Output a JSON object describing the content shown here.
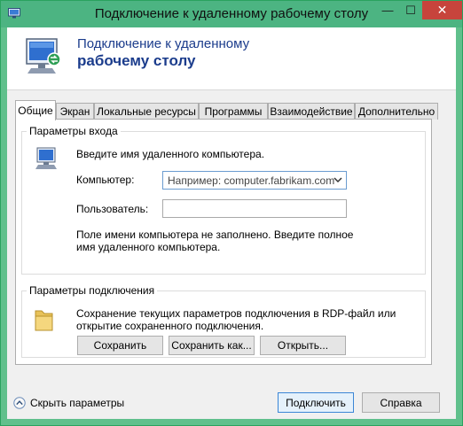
{
  "window": {
    "title": "Подключение к удаленному рабочему столу",
    "min_glyph": "—",
    "max_glyph": "☐",
    "close_glyph": "✕"
  },
  "banner": {
    "line1": "Подключение к удаленному",
    "line2": "рабочему столу"
  },
  "tabs": [
    {
      "label": "Общие",
      "active": true
    },
    {
      "label": "Экран"
    },
    {
      "label": "Локальные ресурсы"
    },
    {
      "label": "Программы"
    },
    {
      "label": "Взаимодействие"
    },
    {
      "label": "Дополнительно"
    }
  ],
  "login": {
    "group_title": "Параметры входа",
    "prompt": "Введите имя удаленного компьютера.",
    "computer_label": "Компьютер:",
    "computer_placeholder": "Например: computer.fabrikam.com",
    "user_label": "Пользователь:",
    "user_value": "",
    "hint_line1": "Поле имени компьютера не заполнено. Введите полное",
    "hint_line2": "имя удаленного компьютера."
  },
  "connection": {
    "group_title": "Параметры подключения",
    "desc_line1": "Сохранение текущих параметров подключения в RDP-файл или",
    "desc_line2": "открытие сохраненного подключения.",
    "save_label": "Сохранить",
    "save_as_label": "Сохранить как...",
    "open_label": "Открыть..."
  },
  "footer": {
    "hide_label": "Скрыть параметры",
    "connect_label": "Подключить",
    "help_label": "Справка"
  },
  "colors": {
    "frame": "#60c08c",
    "close": "#c7443c",
    "banner_text": "#1b3c8c",
    "default_button_border": "#3b86d6"
  }
}
